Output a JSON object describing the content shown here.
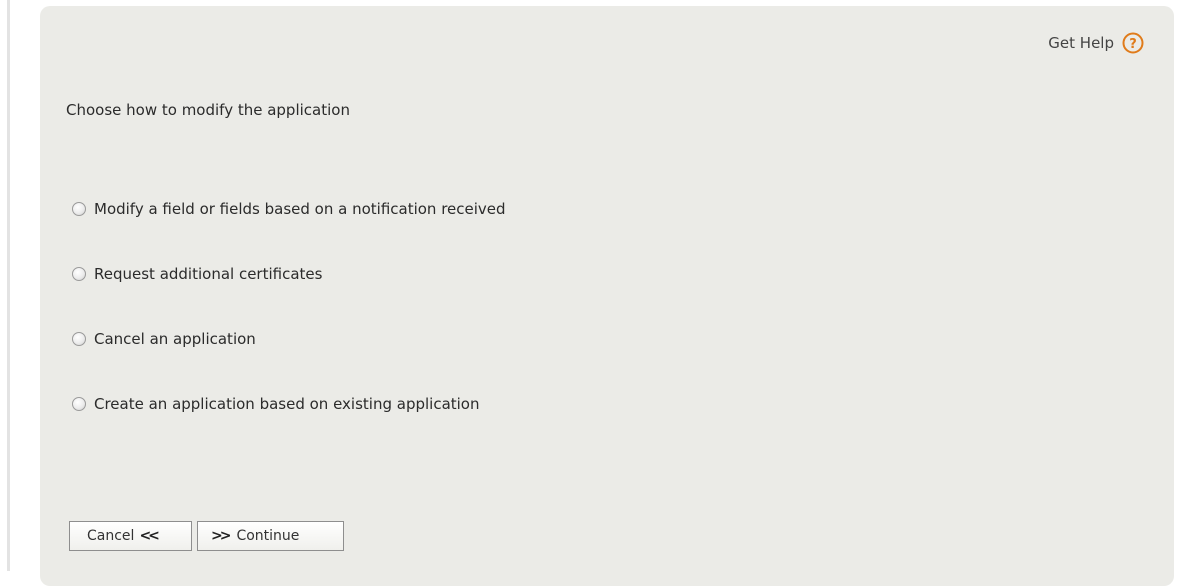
{
  "help": {
    "label": "Get Help",
    "icon": "question-circle-icon",
    "icon_color": "#e07b1a"
  },
  "heading": "Choose how to modify the application",
  "options": [
    {
      "label": "Modify a field or fields based on a notification received",
      "selected": false
    },
    {
      "label": "Request additional certificates",
      "selected": false
    },
    {
      "label": "Cancel an application",
      "selected": false
    },
    {
      "label": "Create an application based on existing application",
      "selected": false
    }
  ],
  "buttons": {
    "cancel": {
      "label": "Cancel",
      "icon": "double-chevron-left-icon",
      "glyph": "<<"
    },
    "continue": {
      "label": "Continue",
      "icon": "double-chevron-right-icon",
      "glyph": ">>"
    }
  },
  "colors": {
    "panel_background": "#ebebe7",
    "accent": "#e07b1a"
  }
}
